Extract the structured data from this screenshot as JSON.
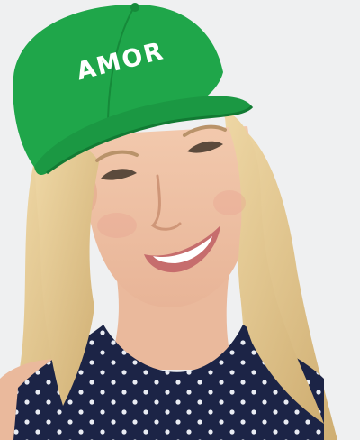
{
  "photo": {
    "cap_text": "AMOR",
    "colors": {
      "background": "#eff0f1",
      "cap": "#1fa64a",
      "cap_shadow": "#168a3a",
      "hair": "#e0c78f",
      "skin": "#f0c4a8",
      "top": "#1c2446",
      "top_pattern": "#e9ecf3"
    }
  }
}
